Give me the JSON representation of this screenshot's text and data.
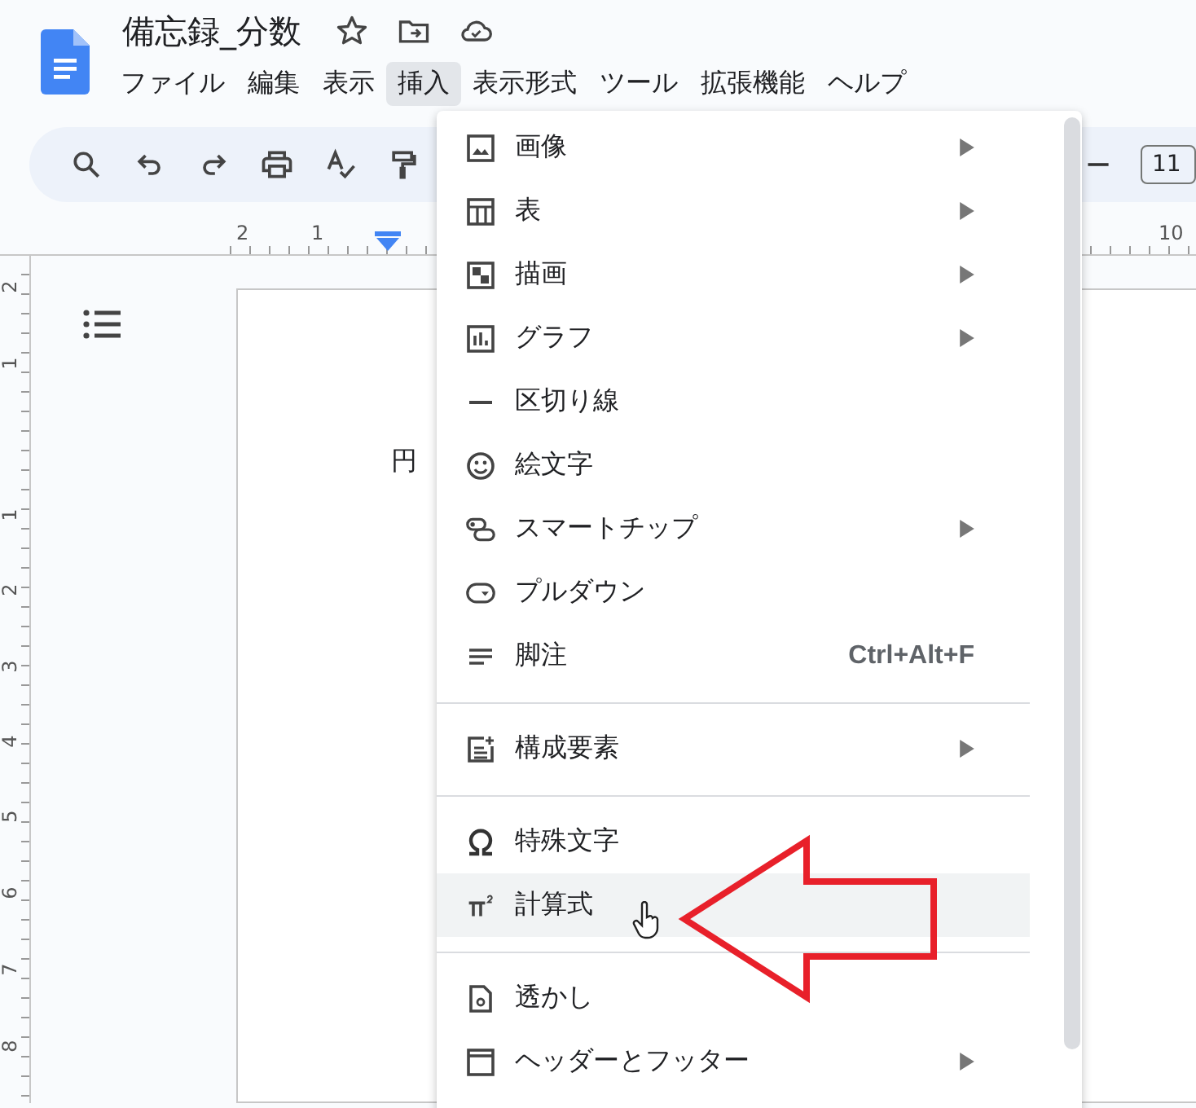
{
  "document": {
    "title": "備忘録_分数",
    "body_text": "円"
  },
  "menubar": [
    {
      "label": "ファイル",
      "selected": false
    },
    {
      "label": "編集",
      "selected": false
    },
    {
      "label": "表示",
      "selected": false
    },
    {
      "label": "挿入",
      "selected": true
    },
    {
      "label": "表示形式",
      "selected": false
    },
    {
      "label": "ツール",
      "selected": false
    },
    {
      "label": "拡張機能",
      "selected": false
    },
    {
      "label": "ヘルプ",
      "selected": false
    }
  ],
  "toolbar": {
    "font_size": "11"
  },
  "ruler": {
    "top_numbers": [
      "2",
      "1",
      "10"
    ],
    "left_numbers": [
      "2",
      "1",
      "1",
      "2",
      "3",
      "4",
      "5",
      "6",
      "7",
      "8"
    ]
  },
  "insert_menu": {
    "sections": [
      [
        {
          "label": "画像",
          "submenu": true,
          "selected": false
        },
        {
          "label": "表",
          "submenu": true,
          "selected": false
        },
        {
          "label": "描画",
          "submenu": true,
          "selected": false
        },
        {
          "label": "グラフ",
          "submenu": true,
          "selected": false
        },
        {
          "label": "区切り線",
          "submenu": false,
          "selected": false
        },
        {
          "label": "絵文字",
          "submenu": false,
          "selected": false
        },
        {
          "label": "スマートチップ",
          "submenu": true,
          "selected": false
        },
        {
          "label": "プルダウン",
          "submenu": false,
          "selected": false
        },
        {
          "label": "脚注",
          "submenu": false,
          "selected": false,
          "shortcut": "Ctrl+Alt+F"
        }
      ],
      [
        {
          "label": "構成要素",
          "submenu": true,
          "selected": false
        }
      ],
      [
        {
          "label": "特殊文字",
          "submenu": false,
          "selected": false
        },
        {
          "label": "計算式",
          "submenu": false,
          "selected": true
        }
      ],
      [
        {
          "label": "透かし",
          "submenu": false,
          "selected": false
        },
        {
          "label": "ヘッダーとフッター",
          "submenu": true,
          "selected": false
        }
      ]
    ]
  }
}
